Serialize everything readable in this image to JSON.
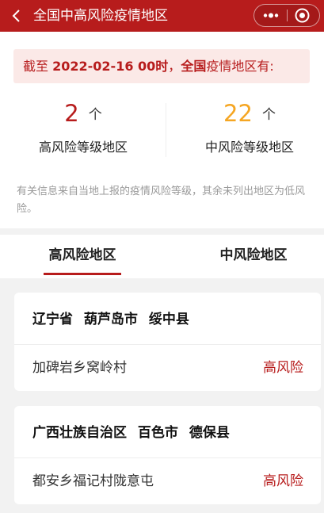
{
  "header": {
    "title": "全国中高风险疫情地区",
    "accent_color": "#b71c1c",
    "icons": [
      "back-icon",
      "more-icon",
      "record-icon"
    ]
  },
  "summary": {
    "notice_prefix": "截至",
    "notice_datetime": "2022-02-16 00时",
    "notice_comma": "，",
    "notice_region": "全国",
    "notice_suffix": "疫情地区有:",
    "high_count": "2",
    "high_unit": "个",
    "high_label": "高风险等级地区",
    "mid_count": "22",
    "mid_unit": "个",
    "mid_label": "中风险等级地区",
    "note": "有关信息来自当地上报的疫情风险等级，其余未列出地区为低风险。"
  },
  "tabs": [
    {
      "label": "高风险地区",
      "active": true
    },
    {
      "label": "中风险地区",
      "active": false
    }
  ],
  "areas": [
    {
      "province": "辽宁省",
      "city": "葫芦岛市",
      "county": "绥中县",
      "place": "加碑岩乡窝岭村",
      "level": "高风险"
    },
    {
      "province": "广西壮族自治区",
      "city": "百色市",
      "county": "德保县",
      "place": "都安乡福记村陇意屯",
      "level": "高风险"
    }
  ]
}
